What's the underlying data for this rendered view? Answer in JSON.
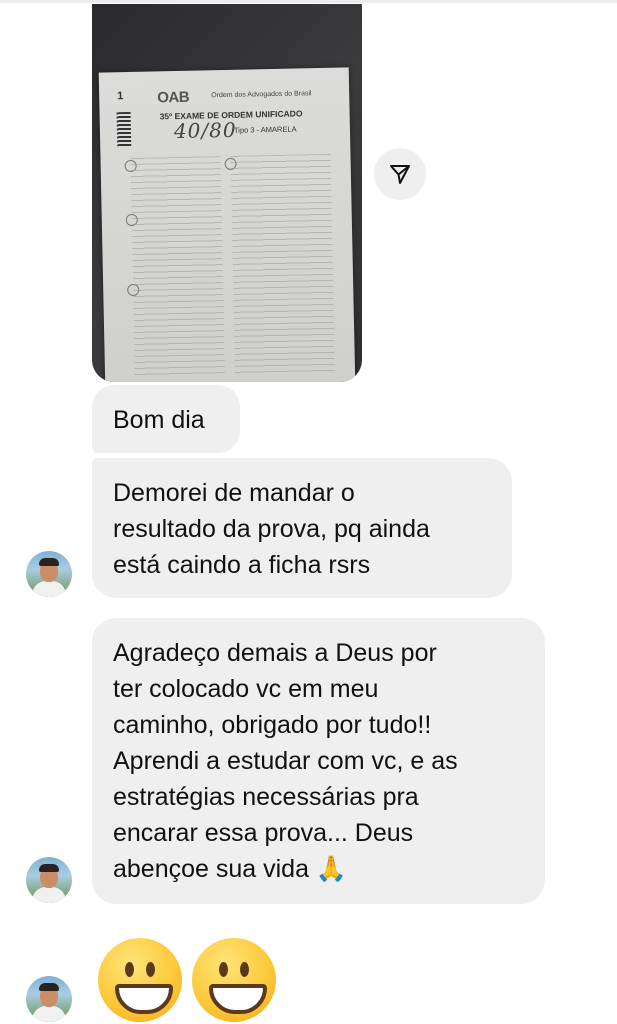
{
  "photo": {
    "page_number": "1",
    "logo_text": "OAB",
    "org_text": "Ordem dos Advogados do Brasil",
    "exam_title": "35º EXAME DE ORDEM UNIFICADO",
    "handwritten_score": "40/80",
    "type_text": "Tipo 3 - AMARELA"
  },
  "messages": [
    {
      "text": "Bom dia"
    },
    {
      "text": "Demorei de mandar o\nresultado da prova, pq ainda\nestá caindo a ficha  rsrs"
    },
    {
      "text": "Agradeço demais a Deus por\nter colocado vc em meu\ncaminho, obrigado por tudo!!\nAprendi a estudar com vc, e as\nestratégias necessárias pra\nencarar essa prova... Deus\nabençoe sua vida 🙏"
    }
  ],
  "emojis": [
    "grinning-face",
    "grinning-face"
  ],
  "icons": {
    "share": "send-arrow-icon"
  }
}
